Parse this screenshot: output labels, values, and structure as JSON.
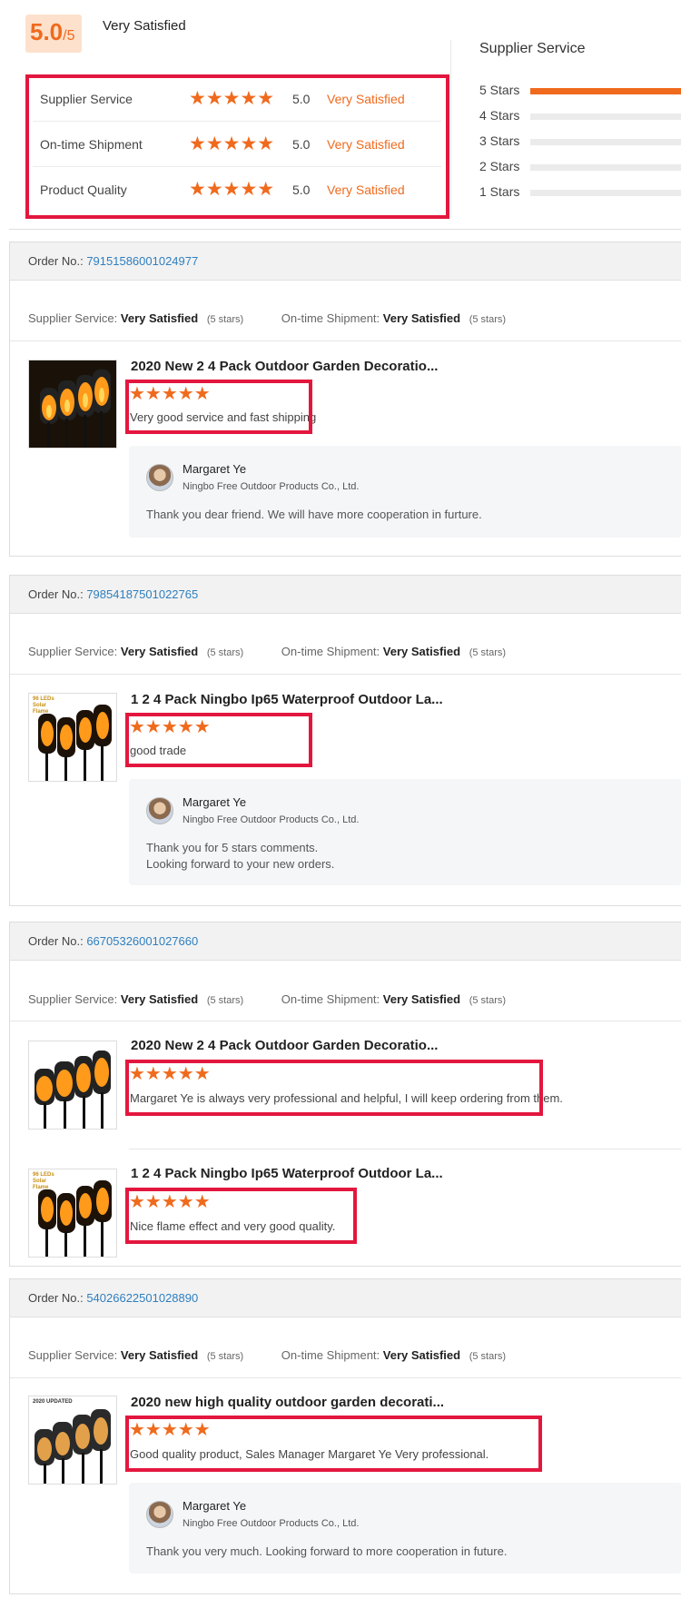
{
  "summary": {
    "score": "5.0",
    "score_suffix": "/5",
    "score_label": "Very Satisfied",
    "rows": [
      {
        "label": "Supplier Service",
        "value": "5.0",
        "rating": "Very Satisfied"
      },
      {
        "label": "On-time Shipment",
        "value": "5.0",
        "rating": "Very Satisfied"
      },
      {
        "label": "Product Quality",
        "value": "5.0",
        "rating": "Very Satisfied"
      }
    ],
    "stars_glyph": "★★★★★",
    "breakdown_title": "Supplier Service",
    "breakdown": [
      {
        "label": "5 Stars",
        "fill": 1.0
      },
      {
        "label": "4 Stars",
        "fill": 0
      },
      {
        "label": "3 Stars",
        "fill": 0
      },
      {
        "label": "2 Stars",
        "fill": 0
      },
      {
        "label": "1 Stars",
        "fill": 0
      }
    ]
  },
  "common": {
    "order_label": "Order No.:",
    "supplier_label": "Supplier Service:",
    "shipment_label": "On-time Shipment:",
    "very_satisfied": "Very Satisfied",
    "five_stars": "(5 stars)",
    "replier_name": "Margaret Ye",
    "replier_company": "Ningbo Free Outdoor Products Co., Ltd.",
    "thumb_badge": "96 LEDs Solar Flame",
    "thumb_badge2": "2020 UPDATED"
  },
  "orders": [
    {
      "order_no": "79151586001024977",
      "items": [
        {
          "title": "2020 New 2 4 Pack Outdoor Garden Decoratio...",
          "comment": "Very good service and fast shipping"
        }
      ],
      "reply": "Thank you dear friend. We will have more cooperation in furture."
    },
    {
      "order_no": "79854187501022765",
      "items": [
        {
          "title": "1 2 4 Pack Ningbo Ip65 Waterproof Outdoor La...",
          "comment": "good trade"
        }
      ],
      "reply_line1": "Thank you for 5 stars comments.",
      "reply_line2": "Looking forward to your new orders."
    },
    {
      "order_no": "66705326001027660",
      "items": [
        {
          "title": "2020 New 2 4 Pack Outdoor Garden Decoratio...",
          "comment": "Margaret Ye is always very professional and helpful, I will keep ordering from them."
        },
        {
          "title": "1 2 4 Pack Ningbo Ip65 Waterproof Outdoor La...",
          "comment": "Nice flame effect and very good quality."
        }
      ]
    },
    {
      "order_no": "54026622501028890",
      "items": [
        {
          "title": "2020 new high quality outdoor garden decorati...",
          "comment": "Good quality product, Sales Manager Margaret Ye Very professional."
        }
      ],
      "reply": "Thank you very much. Looking forward to more cooperation in future."
    }
  ],
  "colors": {
    "accent": "#f06a1d",
    "highlight_box": "#e3173e",
    "link": "#2f7fbf"
  }
}
